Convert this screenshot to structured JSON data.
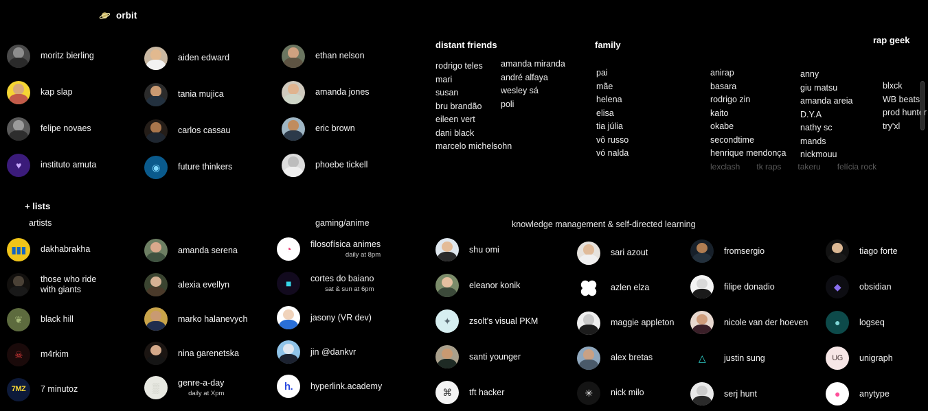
{
  "app": {
    "title": "orbit",
    "title_icon": "planet-icon"
  },
  "lists_header": {
    "label": "+ lists"
  },
  "groups": {
    "orbit_people": {
      "columns": [
        {
          "name": "orbit-col-1",
          "items": [
            {
              "name": "moritz bierling"
            },
            {
              "name": "kap slap"
            },
            {
              "name": "felipe novaes"
            },
            {
              "name": "instituto amuta"
            }
          ]
        },
        {
          "name": "orbit-col-2",
          "items": [
            {
              "name": "aiden edward"
            },
            {
              "name": "tania mujica"
            },
            {
              "name": "carlos cassau"
            },
            {
              "name": "future thinkers"
            }
          ]
        },
        {
          "name": "orbit-col-3",
          "items": [
            {
              "name": "ethan nelson"
            },
            {
              "name": "amanda jones"
            },
            {
              "name": "eric brown"
            },
            {
              "name": "phoebe tickell"
            }
          ]
        }
      ]
    },
    "distant_friends": {
      "title": "distant friends",
      "columns": [
        [
          "rodrigo teles",
          "mari",
          "susan",
          "bru brandão",
          "eileen vert",
          "dani black",
          "marcelo michelsohn"
        ],
        [
          "amanda miranda",
          "andré alfaya",
          "wesley sá",
          "poli"
        ]
      ]
    },
    "family": {
      "title": "family",
      "columns": [
        [
          "pai",
          "mãe",
          "helena",
          "elisa",
          "tia júlia",
          "vô russo",
          "vó nalda"
        ]
      ]
    },
    "rap_geek": {
      "title": "rap geek",
      "columns": [
        [
          "anirap",
          "basara",
          "rodrigo zin",
          "kaito",
          "okabe",
          "secondtime",
          "henrique mendonça"
        ],
        [
          "anny",
          "giu matsu",
          "amanda areia",
          "D.Y.A",
          "nathy sc",
          "mands",
          "nickmouu"
        ],
        [
          "blxck",
          "WB beats",
          "prod hunter",
          "try'xl"
        ]
      ],
      "muted": [
        "lexclash",
        "tk raps",
        "takeru",
        "felícia rock"
      ]
    },
    "artists": {
      "title": "artists",
      "columns": [
        {
          "name": "artists-col-1",
          "items": [
            {
              "name": "dakhabrakha"
            },
            {
              "name": "those who ride\nwith giants"
            },
            {
              "name": "black hill"
            },
            {
              "name": "m4rkim"
            },
            {
              "name": "7 minutoz"
            }
          ]
        },
        {
          "name": "artists-col-2",
          "items": [
            {
              "name": "amanda serena"
            },
            {
              "name": "alexia evellyn"
            },
            {
              "name": "marko halanevych"
            },
            {
              "name": "nina garenetska"
            },
            {
              "name": "genre-a-day",
              "sub": "daily at Xpm"
            }
          ]
        }
      ]
    },
    "gaming_anime": {
      "title": "gaming/anime",
      "columns": [
        {
          "name": "gaming-col-1",
          "items": [
            {
              "name": "filosofísica animes",
              "sub": "daily at 8pm"
            },
            {
              "name": "cortes do baiano",
              "sub": "sat & sun at 6pm"
            },
            {
              "name": "jasony (VR dev)"
            },
            {
              "name": "jin @dankvr"
            },
            {
              "name": "hyperlink.academy"
            }
          ]
        }
      ]
    },
    "knowledge": {
      "title": "knowledge management & self-directed learning",
      "columns": [
        {
          "name": "knowledge-col-1",
          "items": [
            {
              "name": "shu omi"
            },
            {
              "name": "eleanor konik"
            },
            {
              "name": "zsolt's visual PKM"
            },
            {
              "name": "santi younger"
            },
            {
              "name": "tft hacker"
            }
          ]
        },
        {
          "name": "knowledge-col-2",
          "items": [
            {
              "name": "sari azout"
            },
            {
              "name": "azlen elza"
            },
            {
              "name": "maggie appleton"
            },
            {
              "name": "alex bretas"
            },
            {
              "name": "nick milo"
            }
          ]
        },
        {
          "name": "knowledge-col-3",
          "items": [
            {
              "name": "fromsergio"
            },
            {
              "name": "filipe donadio"
            },
            {
              "name": "nicole van der hoeven"
            },
            {
              "name": "justin sung"
            },
            {
              "name": "serj hunt"
            }
          ]
        },
        {
          "name": "knowledge-col-4",
          "items": [
            {
              "name": "tiago forte"
            },
            {
              "name": "obsidian"
            },
            {
              "name": "logseq"
            },
            {
              "name": "unigraph"
            },
            {
              "name": "anytype"
            }
          ]
        }
      ]
    }
  },
  "colors": {
    "background": "#000000",
    "text": "#f2f2f2",
    "muted_text": "#5a5a5a",
    "scrollbar_thumb": "#4a4a4a"
  }
}
